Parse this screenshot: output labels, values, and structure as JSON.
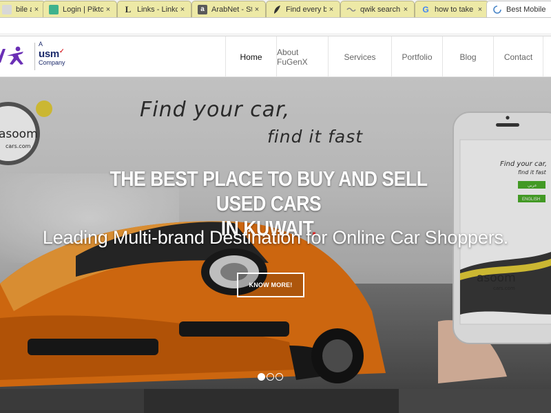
{
  "browser": {
    "tabs": [
      {
        "title": "bile app d",
        "icon": "generic-page-icon",
        "active": false
      },
      {
        "title": "Login | Pikto",
        "icon": "piktochart-icon",
        "active": false
      },
      {
        "title": "Links - Linkc",
        "icon": "letter-l-icon",
        "active": false
      },
      {
        "title": "ArabNet - St",
        "icon": "letter-a-icon",
        "active": false
      },
      {
        "title": "Find every bi",
        "icon": "leaf-icon",
        "active": false
      },
      {
        "title": "qwik search",
        "icon": "qwik-icon",
        "active": false
      },
      {
        "title": "how to take",
        "icon": "google-icon",
        "active": false
      },
      {
        "title": "Best Mobile",
        "icon": "loading-spinner-icon",
        "active": true
      }
    ],
    "close_glyph": "×"
  },
  "header": {
    "logo": {
      "a": "A",
      "usm": "usm",
      "co": "Company"
    },
    "nav": [
      {
        "label": "Home",
        "active": true
      },
      {
        "label": "About FuGenX",
        "active": false
      },
      {
        "label": "Services",
        "active": false
      },
      {
        "label": "Portfolio",
        "active": false
      },
      {
        "label": "Blog",
        "active": false
      },
      {
        "label": "Contact",
        "active": false
      }
    ]
  },
  "hero": {
    "tagline_line1": "Find your car,",
    "tagline_line2": "find it fast",
    "headline_line1": "THE BEST PLACE TO BUY AND SELL USED CARS",
    "headline_line2": "IN KUWAIT",
    "headline_dot": ".",
    "subheadline": "Leading Multi-brand Destination for Online Car Shoppers.",
    "button_label": "KNOW MORE!",
    "badge_text": "asoom",
    "badge_sub": "cars.com",
    "phone": {
      "line1": "Find your car,",
      "line2": "find it fast",
      "btn_arabic": "عربي",
      "btn_english": "ENGLISH",
      "logo": "asoom",
      "logo_sub": "cars.com"
    },
    "carousel": {
      "count": 3,
      "active": 0
    }
  },
  "colors": {
    "tab_bg": "#ede9a6",
    "accent_red": "#e02424",
    "usm_blue": "#1b2a6b",
    "logo_purple": "#6a2fb5",
    "phone_green": "#4caf2a"
  }
}
